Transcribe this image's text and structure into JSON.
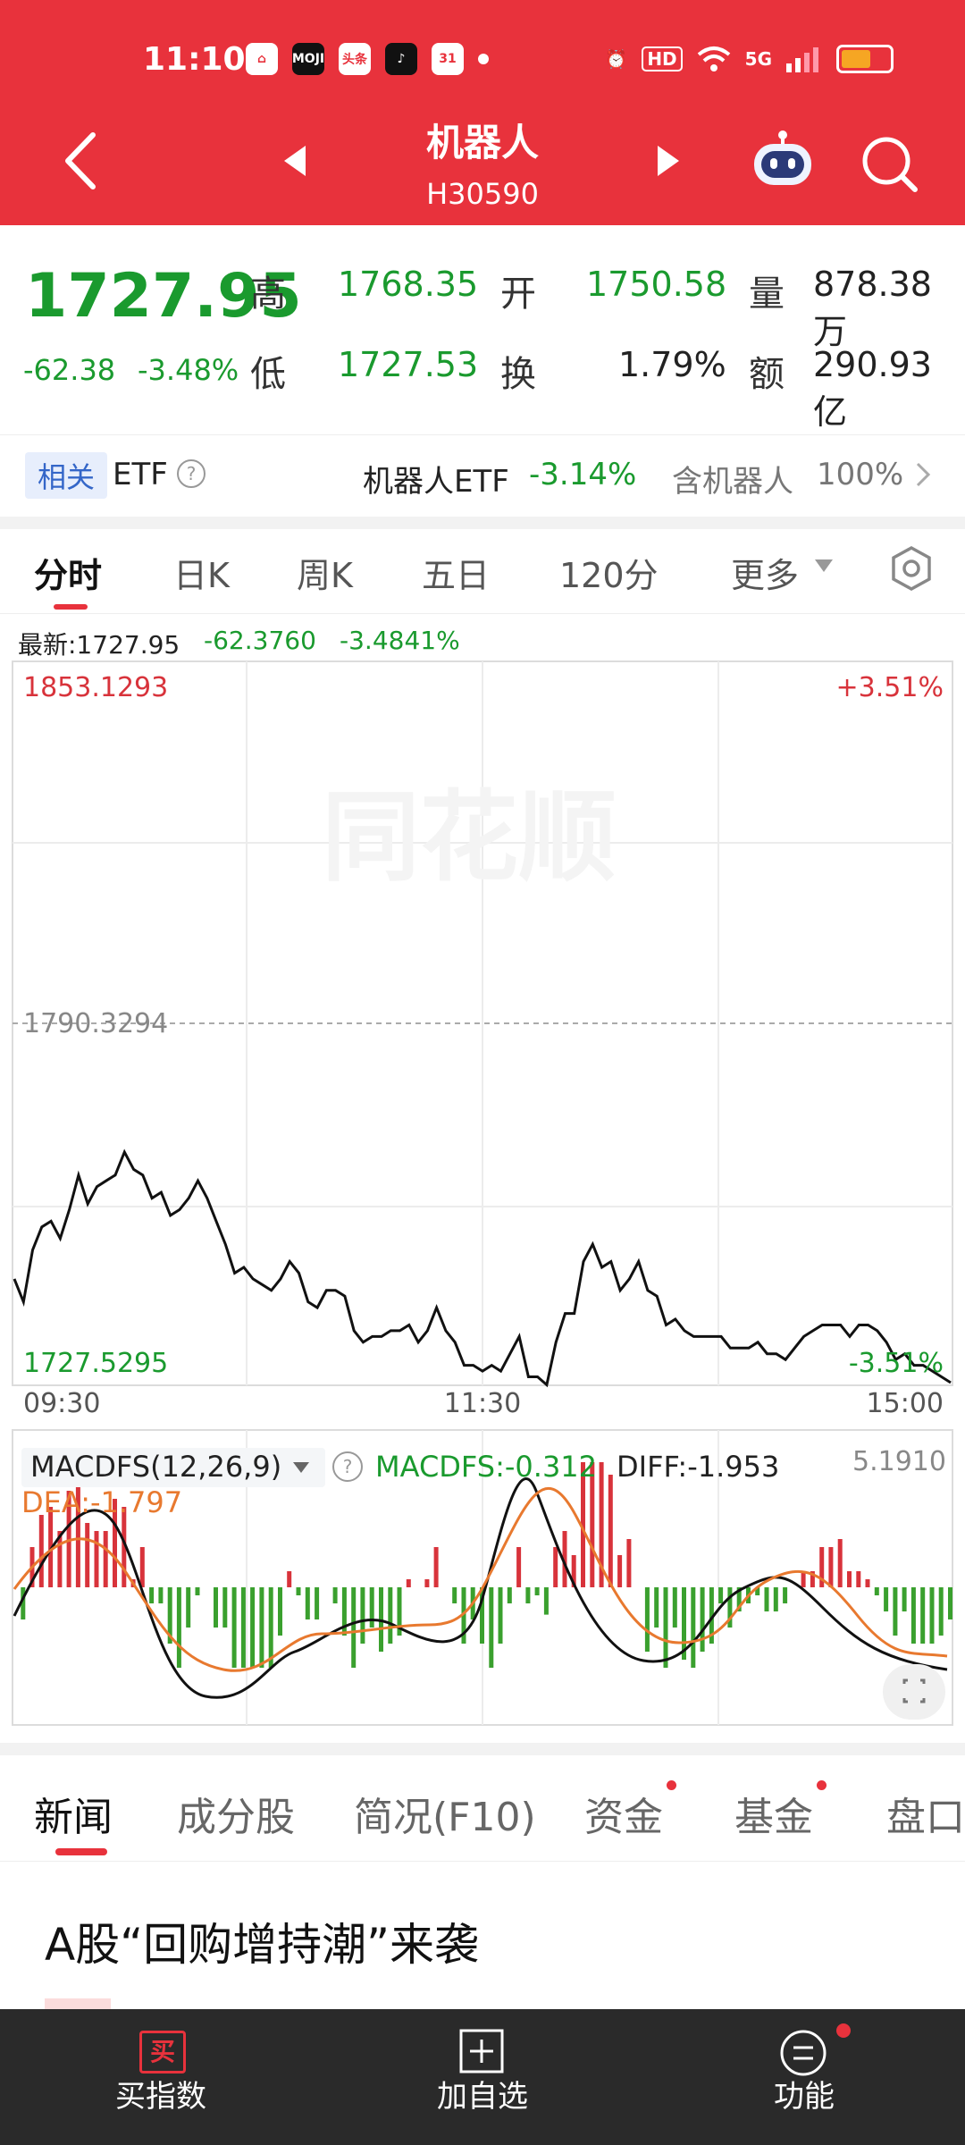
{
  "status": {
    "time": "11:10",
    "app_icons": [
      "⌂",
      "MOJI",
      "头条",
      "♪",
      "31"
    ],
    "hd": "HD",
    "signal": "5G"
  },
  "header": {
    "title": "机器人",
    "code": "H30590"
  },
  "quote": {
    "price": "1727.95",
    "change": "-62.38",
    "change_pct": "-3.48%",
    "high_label": "高",
    "high": "1768.35",
    "open_label": "开",
    "open": "1750.58",
    "volume_label": "量",
    "volume": "878.38万",
    "low_label": "低",
    "low": "1727.53",
    "turnover_label": "换",
    "turnover": "1.79%",
    "amount_label": "额",
    "amount": "290.93亿"
  },
  "etf": {
    "tag": "相关",
    "label": "ETF",
    "name": "机器人ETF",
    "pct": "-3.14%",
    "contains": "含机器人",
    "contains_pct": "100%"
  },
  "chart_tabs": [
    "分时",
    "日K",
    "周K",
    "五日",
    "120分",
    "更多"
  ],
  "latest": {
    "label": "最新:1727.95",
    "change": "-62.3760",
    "pct": "-3.4841%"
  },
  "chart_labels": {
    "top_price": "1853.1293",
    "top_pct": "+3.51%",
    "mid_price": "1790.3294",
    "bottom_price": "1727.5295",
    "bottom_pct": "-3.51%",
    "t_start": "09:30",
    "t_mid": "11:30",
    "t_end": "15:00"
  },
  "macd": {
    "title": "MACDFS(12,26,9)",
    "macdfs": "MACDFS:-0.312",
    "diff": "DIFF:-1.953",
    "dea": "DEA:-1.797",
    "max": "5.1910"
  },
  "news_tabs": [
    "新闻",
    "成分股",
    "简况(F10)",
    "资金",
    "基金",
    "盘口"
  ],
  "headline": "A股“回购增持潮”来袭",
  "bottom_bar": {
    "buy": "买指数",
    "buy_icon_text": "买",
    "add": "加自选",
    "func": "功能"
  },
  "chart_data": {
    "type": "line",
    "title": "",
    "xlabel": "",
    "ylabel": "",
    "x_ticks": [
      "09:30",
      "11:30",
      "15:00"
    ],
    "ylim": [
      1727.5295,
      1853.1293
    ],
    "reference": 1790.3294,
    "series": [
      {
        "values": [
          1746,
          1742,
          1751,
          1755,
          1756,
          1753,
          1758,
          1764,
          1759,
          1762,
          1763,
          1764,
          1768,
          1765,
          1764,
          1760,
          1761,
          1757,
          1758,
          1760,
          1763,
          1760,
          1756,
          1752,
          1747,
          1748,
          1746,
          1745,
          1744,
          1746,
          1749,
          1747,
          1742,
          1741,
          1744,
          1744,
          1743,
          1737,
          1735,
          1736,
          1736,
          1737,
          1737,
          1738,
          1735,
          1737,
          1741,
          1737,
          1735,
          1731,
          1731,
          1730,
          1731,
          1730,
          1733,
          1736,
          1729,
          1729,
          1727.6,
          1735,
          1740,
          1740,
          1749,
          1752,
          1748,
          1749,
          1744,
          1746,
          1749,
          1744,
          1743,
          1738,
          1739,
          1737,
          1736,
          1736,
          1736,
          1736,
          1734,
          1734,
          1734,
          1735,
          1733,
          1733,
          1732,
          1734,
          1736,
          1737,
          1738,
          1738,
          1738,
          1736,
          1738,
          1738,
          1737,
          1735,
          1732,
          1733,
          1731,
          1731,
          1730,
          1729,
          1728
        ]
      }
    ]
  }
}
